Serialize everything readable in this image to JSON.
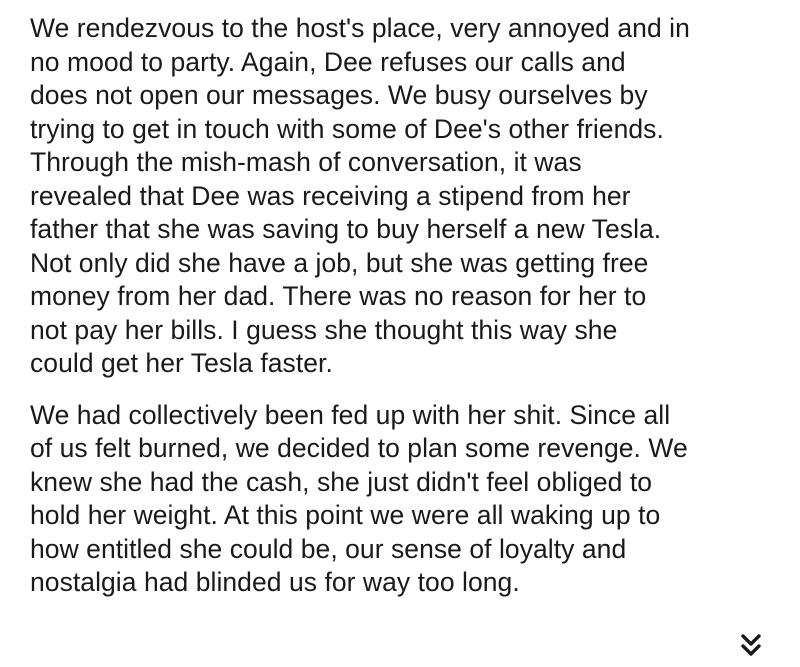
{
  "paragraphs": [
    {
      "lines": [
        "We rendezvous to the host's place, very annoyed and in",
        "no mood to party. Again, Dee refuses our calls and",
        "does not open our messages. We busy ourselves by",
        "trying to get in touch with some of Dee's other friends.",
        "Through the mish-mash of conversation, it was",
        "revealed that Dee was receiving a stipend from her",
        "father that she was saving to buy herself a new Tesla.",
        "Not only did she have a job, but she was getting free",
        "money from her dad. There was no reason for her to",
        "not pay her bills. I guess she thought this way she",
        "could get her Tesla faster."
      ]
    },
    {
      "lines": [
        "We had collectively been fed up with her shit. Since all",
        "of us felt burned, we decided to plan some revenge. We",
        "knew she had the cash, she just didn't feel obliged to",
        "hold her weight. At this point we were all waking up to",
        "how entitled she could be, our sense of loyalty and",
        "nostalgia had blinded us for way too long."
      ]
    }
  ],
  "controls": {
    "scroll_more_icon": "double-chevron-down-icon"
  }
}
